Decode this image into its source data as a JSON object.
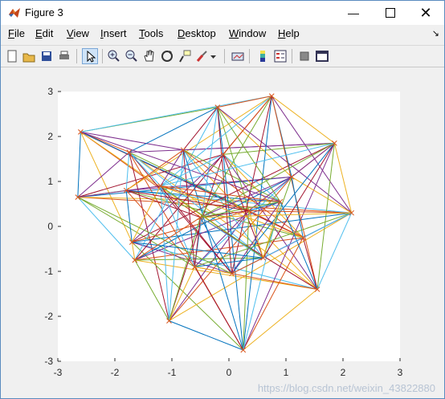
{
  "window": {
    "title": "Figure 3",
    "icons": [
      "matlab-icon",
      "minimize-icon",
      "maximize-icon",
      "close-icon"
    ]
  },
  "menu": {
    "items": [
      {
        "label": "File",
        "mnemonic": "F"
      },
      {
        "label": "Edit",
        "mnemonic": "E"
      },
      {
        "label": "View",
        "mnemonic": "V"
      },
      {
        "label": "Insert",
        "mnemonic": "I"
      },
      {
        "label": "Tools",
        "mnemonic": "T"
      },
      {
        "label": "Desktop",
        "mnemonic": "D"
      },
      {
        "label": "Window",
        "mnemonic": "W"
      },
      {
        "label": "Help",
        "mnemonic": "H"
      }
    ],
    "overflow_arrow": "↘"
  },
  "toolbar": {
    "buttons": [
      "new-figure-icon",
      "open-file-icon",
      "save-icon",
      "print-icon",
      "edit-plot-arrow-icon",
      "zoom-in-icon",
      "zoom-out-icon",
      "pan-hand-icon",
      "rotate-3d-icon",
      "data-cursor-icon",
      "brush-icon",
      "link-plot-icon",
      "colorbar-icon",
      "legend-icon",
      "hide-tools-icon",
      "show-tools-icon"
    ]
  },
  "chart_data": {
    "type": "line",
    "title": "",
    "xlabel": "",
    "ylabel": "",
    "xlim": [
      -3,
      3
    ],
    "ylim": [
      -3,
      3
    ],
    "xticks": [
      "-3",
      "-2",
      "-1",
      "0",
      "1",
      "2",
      "3"
    ],
    "yticks": [
      "3",
      "2",
      "1",
      "0",
      "-1",
      "-2",
      "-3"
    ],
    "grid": false,
    "series_colors": [
      "#0072BD",
      "#D95319",
      "#EDB120",
      "#7E2F8E",
      "#77AC30",
      "#4DBEEE",
      "#A2142F"
    ],
    "nodes": [
      [
        -2.6,
        2.1
      ],
      [
        -2.65,
        0.65
      ],
      [
        -1.75,
        1.65
      ],
      [
        -1.8,
        0.8
      ],
      [
        -1.7,
        -0.35
      ],
      [
        -1.65,
        -0.75
      ],
      [
        -1.05,
        -2.1
      ],
      [
        -0.8,
        1.7
      ],
      [
        -0.2,
        2.65
      ],
      [
        -0.1,
        1.6
      ],
      [
        0.25,
        -2.75
      ],
      [
        0.75,
        2.9
      ],
      [
        1.1,
        1.1
      ],
      [
        1.3,
        -0.25
      ],
      [
        1.55,
        -1.4
      ],
      [
        1.85,
        1.85
      ],
      [
        2.15,
        0.3
      ],
      [
        0.35,
        0.35
      ],
      [
        -0.5,
        0.2
      ],
      [
        0.9,
        0.55
      ],
      [
        -1.2,
        0.9
      ],
      [
        0.6,
        -0.7
      ],
      [
        -0.6,
        -0.9
      ],
      [
        0.05,
        -1.05
      ]
    ],
    "edges": [
      [
        0,
        1
      ],
      [
        0,
        2
      ],
      [
        0,
        4
      ],
      [
        0,
        7
      ],
      [
        0,
        8
      ],
      [
        0,
        11
      ],
      [
        0,
        13
      ],
      [
        0,
        17
      ],
      [
        0,
        18
      ],
      [
        0,
        21
      ],
      [
        1,
        2
      ],
      [
        1,
        3
      ],
      [
        1,
        5
      ],
      [
        1,
        9
      ],
      [
        1,
        12
      ],
      [
        1,
        16
      ],
      [
        1,
        19
      ],
      [
        1,
        20
      ],
      [
        1,
        22
      ],
      [
        2,
        3
      ],
      [
        2,
        6
      ],
      [
        2,
        8
      ],
      [
        2,
        10
      ],
      [
        2,
        14
      ],
      [
        2,
        15
      ],
      [
        2,
        17
      ],
      [
        2,
        21
      ],
      [
        2,
        23
      ],
      [
        3,
        4
      ],
      [
        3,
        7
      ],
      [
        3,
        11
      ],
      [
        3,
        12
      ],
      [
        3,
        13
      ],
      [
        3,
        16
      ],
      [
        3,
        18
      ],
      [
        3,
        19
      ],
      [
        3,
        22
      ],
      [
        4,
        5
      ],
      [
        4,
        9
      ],
      [
        4,
        10
      ],
      [
        4,
        14
      ],
      [
        4,
        15
      ],
      [
        4,
        16
      ],
      [
        4,
        17
      ],
      [
        4,
        20
      ],
      [
        4,
        23
      ],
      [
        5,
        6
      ],
      [
        5,
        8
      ],
      [
        5,
        11
      ],
      [
        5,
        12
      ],
      [
        5,
        13
      ],
      [
        5,
        14
      ],
      [
        5,
        19
      ],
      [
        5,
        21
      ],
      [
        6,
        7
      ],
      [
        6,
        9
      ],
      [
        6,
        10
      ],
      [
        6,
        12
      ],
      [
        6,
        16
      ],
      [
        6,
        17
      ],
      [
        6,
        18
      ],
      [
        6,
        20
      ],
      [
        7,
        8
      ],
      [
        7,
        10
      ],
      [
        7,
        13
      ],
      [
        7,
        14
      ],
      [
        7,
        15
      ],
      [
        7,
        19
      ],
      [
        7,
        21
      ],
      [
        7,
        22
      ],
      [
        8,
        9
      ],
      [
        8,
        11
      ],
      [
        8,
        12
      ],
      [
        8,
        16
      ],
      [
        8,
        17
      ],
      [
        8,
        22
      ],
      [
        8,
        23
      ],
      [
        9,
        10
      ],
      [
        9,
        11
      ],
      [
        9,
        13
      ],
      [
        9,
        14
      ],
      [
        9,
        15
      ],
      [
        9,
        19
      ],
      [
        9,
        21
      ],
      [
        10,
        11
      ],
      [
        10,
        13
      ],
      [
        10,
        14
      ],
      [
        10,
        15
      ],
      [
        10,
        17
      ],
      [
        10,
        19
      ],
      [
        10,
        22
      ],
      [
        11,
        12
      ],
      [
        11,
        14
      ],
      [
        11,
        15
      ],
      [
        11,
        16
      ],
      [
        11,
        18
      ],
      [
        11,
        20
      ],
      [
        11,
        23
      ],
      [
        12,
        13
      ],
      [
        12,
        15
      ],
      [
        12,
        16
      ],
      [
        12,
        18
      ],
      [
        12,
        21
      ],
      [
        12,
        22
      ],
      [
        13,
        14
      ],
      [
        13,
        16
      ],
      [
        13,
        17
      ],
      [
        13,
        20
      ],
      [
        13,
        23
      ],
      [
        14,
        15
      ],
      [
        14,
        16
      ],
      [
        14,
        18
      ],
      [
        14,
        19
      ],
      [
        14,
        22
      ],
      [
        15,
        16
      ],
      [
        15,
        17
      ],
      [
        15,
        18
      ],
      [
        15,
        20
      ],
      [
        15,
        21
      ],
      [
        15,
        23
      ],
      [
        16,
        17
      ],
      [
        16,
        18
      ],
      [
        16,
        21
      ],
      [
        16,
        22
      ],
      [
        16,
        23
      ],
      [
        17,
        18
      ],
      [
        17,
        19
      ],
      [
        17,
        20
      ],
      [
        17,
        21
      ],
      [
        17,
        22
      ],
      [
        18,
        19
      ],
      [
        18,
        21
      ],
      [
        18,
        22
      ],
      [
        18,
        23
      ],
      [
        19,
        20
      ],
      [
        19,
        21
      ],
      [
        19,
        23
      ],
      [
        20,
        21
      ],
      [
        20,
        22
      ],
      [
        20,
        23
      ],
      [
        21,
        22
      ],
      [
        21,
        23
      ],
      [
        22,
        23
      ],
      [
        0,
        19
      ],
      [
        1,
        23
      ],
      [
        2,
        20
      ],
      [
        3,
        17
      ],
      [
        4,
        21
      ],
      [
        5,
        18
      ],
      [
        6,
        22
      ],
      [
        7,
        20
      ],
      [
        8,
        19
      ],
      [
        9,
        20
      ]
    ],
    "marker": "x",
    "marker_color": "#D95319"
  },
  "watermark": "https://blog.csdn.net/weixin_43822880"
}
